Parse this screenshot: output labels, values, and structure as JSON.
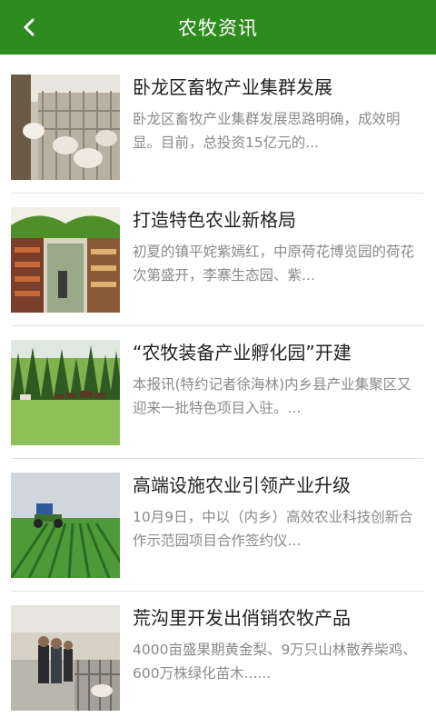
{
  "header": {
    "title": "农牧资讯",
    "back_icon": "chevron-left-icon",
    "background": "#2e8b1e"
  },
  "news": [
    {
      "title": "卧龙区畜牧产业集群发展",
      "summary": "卧龙区畜牧产业集群发展思路明确，成效明显。目前，总投资15亿元的...",
      "image": "livestock-barn-image"
    },
    {
      "title": "打造特色农业新格局",
      "summary": "初夏的镇平姹紫嫣红，中原荷花博览园的荷花次第盛开，李寨生态园、紫...",
      "image": "greenhouse-market-image"
    },
    {
      "title": "“农牧装备产业孵化园”开建",
      "summary": "本报讯(特约记者徐海林)内乡县产业集聚区又迎来一批特色项目入驻。...",
      "image": "cattle-pasture-image"
    },
    {
      "title": "高端设施农业引领产业升级",
      "summary": "10月9日，中以（内乡）高效农业科技创新合作示范园项目合作签约仪...",
      "image": "tractor-field-image"
    },
    {
      "title": "荒沟里开发出俏销农牧产品",
      "summary": "4000亩盛果期黄金梨、9万只山林散养柴鸡、600万株绿化苗木......",
      "image": "farm-visit-image"
    }
  ]
}
